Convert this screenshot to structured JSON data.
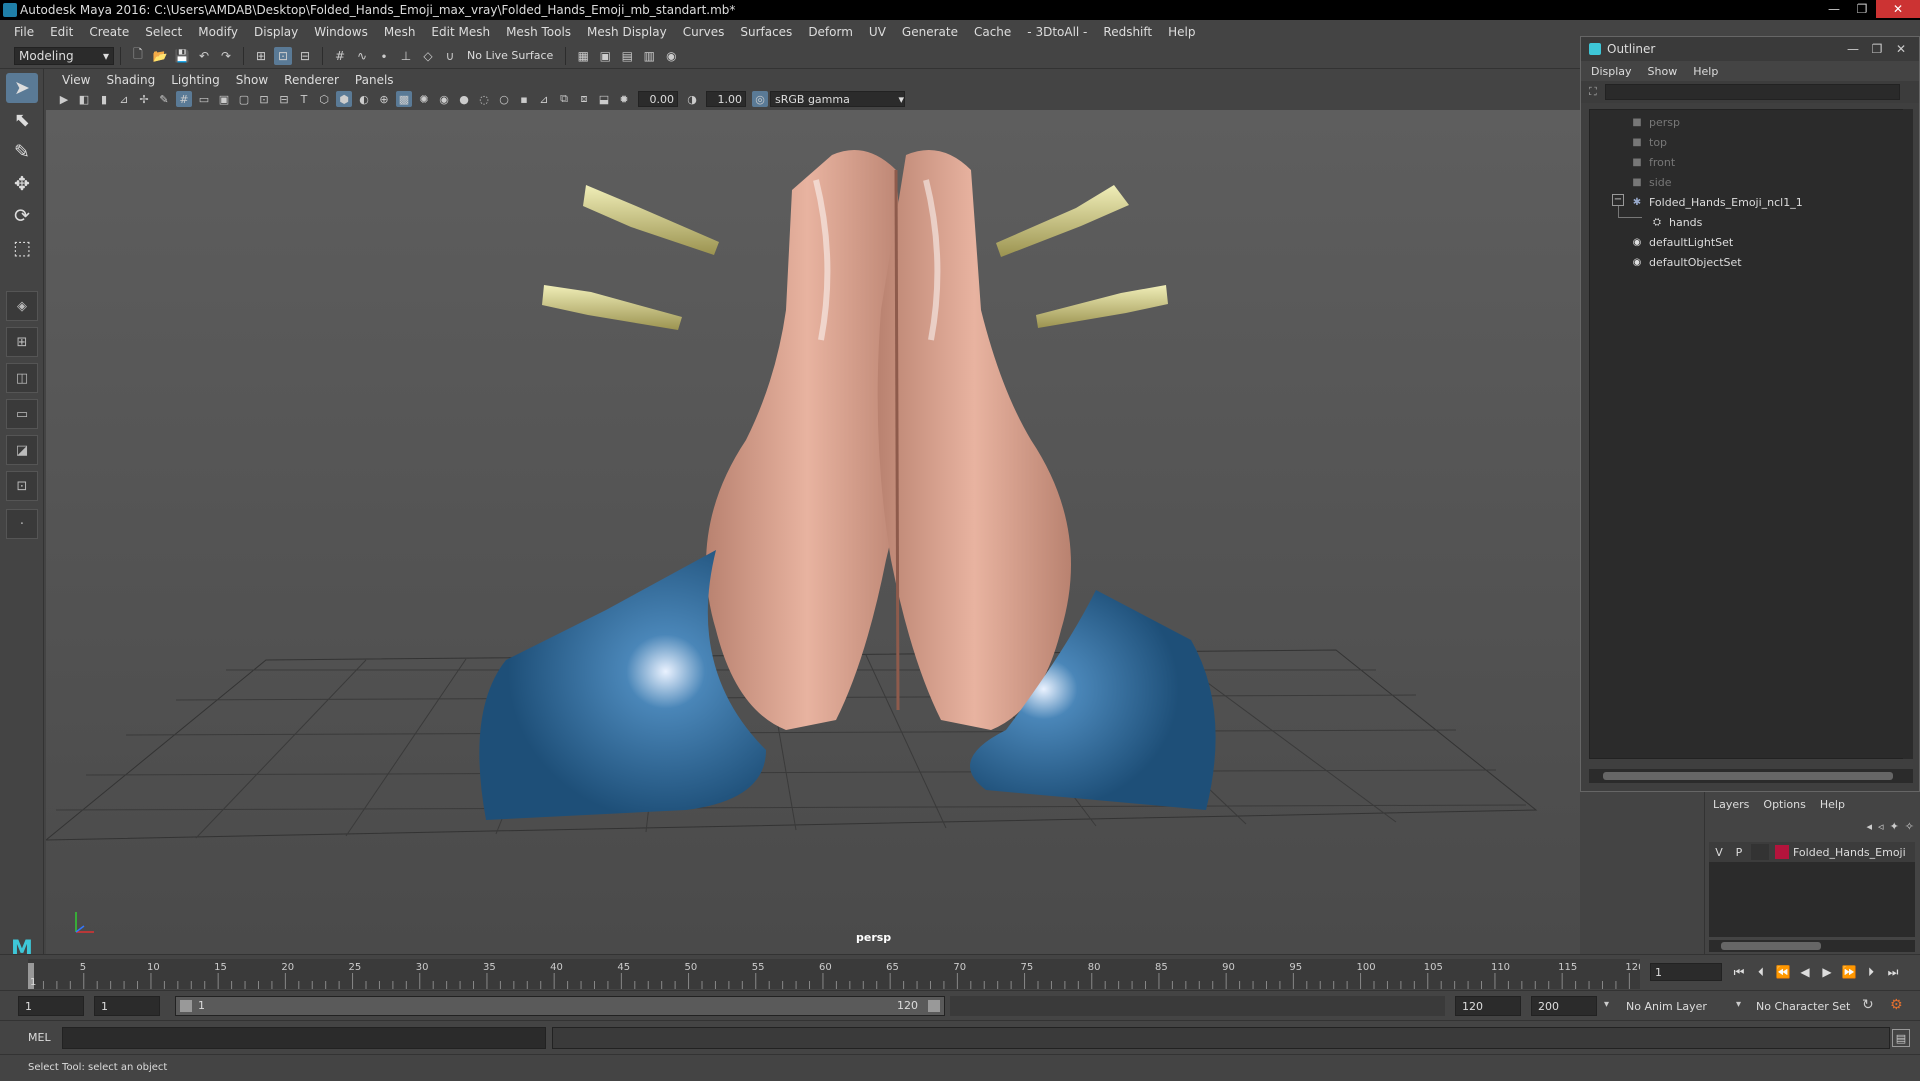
{
  "window": {
    "title": "Autodesk Maya 2016: C:\\Users\\AMDAB\\Desktop\\Folded_Hands_Emoji_max_vray\\Folded_Hands_Emoji_mb_standart.mb*",
    "min_label": "—",
    "max_label": "❐",
    "close_label": "✕"
  },
  "menubar": [
    "File",
    "Edit",
    "Create",
    "Select",
    "Modify",
    "Display",
    "Windows",
    "Mesh",
    "Edit Mesh",
    "Mesh Tools",
    "Mesh Display",
    "Curves",
    "Surfaces",
    "Deform",
    "UV",
    "Generate",
    "Cache",
    "- 3DtoAll -",
    "Redshift",
    "Help"
  ],
  "statusline": {
    "menuset": "Modeling",
    "live_surface": "No Live Surface"
  },
  "panel": {
    "menus": [
      "View",
      "Shading",
      "Lighting",
      "Show",
      "Renderer",
      "Panels"
    ],
    "exposure": "0.00",
    "gamma_value": "1.00",
    "colorspace": "sRGB gamma",
    "camera_label": "persp"
  },
  "outliner": {
    "title": "Outliner",
    "menus": [
      "Display",
      "Show",
      "Help"
    ],
    "items": [
      {
        "label": "persp",
        "icon": "camera-icon",
        "state": "dim"
      },
      {
        "label": "top",
        "icon": "camera-icon",
        "state": "dim"
      },
      {
        "label": "front",
        "icon": "camera-icon",
        "state": "dim"
      },
      {
        "label": "side",
        "icon": "camera-icon",
        "state": "dim"
      },
      {
        "label": "Folded_Hands_Emoji_ncl1_1",
        "icon": "transform-icon",
        "state": "lit"
      },
      {
        "label": "hands",
        "icon": "mesh-icon",
        "state": "lit"
      },
      {
        "label": "defaultLightSet",
        "icon": "set-icon",
        "state": "lit"
      },
      {
        "label": "defaultObjectSet",
        "icon": "set-icon",
        "state": "lit"
      }
    ],
    "expander_label": "−"
  },
  "layers": {
    "menus": [
      "Layers",
      "Options",
      "Help"
    ],
    "row": {
      "v": "V",
      "p": "P",
      "name": "Folded_Hands_Emoji",
      "color": "#b4143c"
    }
  },
  "timeline": {
    "ticks": [
      "5",
      "10",
      "15",
      "20",
      "25",
      "30",
      "35",
      "40",
      "45",
      "50",
      "55",
      "60",
      "65",
      "70",
      "75",
      "80",
      "85",
      "90",
      "95",
      "100",
      "105",
      "110",
      "115",
      "120"
    ],
    "start_tick": "1",
    "current_frame": "1"
  },
  "range": {
    "start": "1",
    "playback_start": "1",
    "slider_start": "1",
    "slider_end": "120",
    "playback_end": "120",
    "end": "200",
    "anim_layer": "No Anim Layer",
    "character_set": "No Character Set"
  },
  "cmd": {
    "mel_label": "MEL"
  },
  "help": {
    "text": "Select Tool: select an object"
  }
}
